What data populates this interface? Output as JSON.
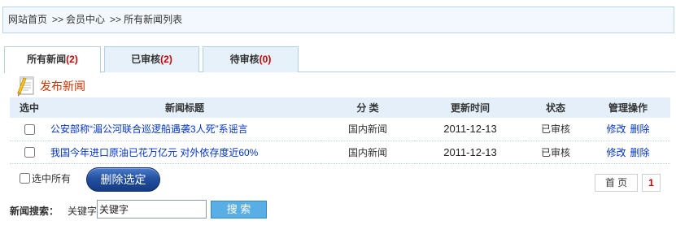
{
  "breadcrumb": {
    "items": [
      "网站首页",
      "会员中心",
      "所有新闻列表"
    ],
    "separator": ">>"
  },
  "tabs": [
    {
      "label": "所有新闻",
      "count": "(2)",
      "active": true
    },
    {
      "label": "已审核",
      "count": "(2)",
      "active": false
    },
    {
      "label": "待审核",
      "count": "(0)",
      "active": false
    }
  ],
  "publish": {
    "label": "发布新闻",
    "icon": "notepad-pencil-icon"
  },
  "table": {
    "headers": [
      "选中",
      "新闻标题",
      "分 类",
      "更新时间",
      "状态",
      "管理操作"
    ],
    "rows": [
      {
        "checked": false,
        "title": "公安部称“湄公河联合巡逻船遇袭3人死”系谣言",
        "category": "国内新闻",
        "updated": "2011-12-13",
        "status": "已审核",
        "edit_label": "修改",
        "delete_label": "删除"
      },
      {
        "checked": false,
        "title": "我国今年进口原油已花万亿元 对外依存度近60%",
        "category": "国内新闻",
        "updated": "2011-12-13",
        "status": "已审核",
        "edit_label": "修改",
        "delete_label": "删除"
      }
    ]
  },
  "bulk": {
    "select_all_label": "选中所有",
    "delete_selected_label": "删除选定"
  },
  "pagination": {
    "first_label": "首 页",
    "current_page": "1"
  },
  "search": {
    "label": "新闻搜索：",
    "keyword_label": "关键字",
    "input_value": "关键字",
    "button_label": "搜 索"
  },
  "colors": {
    "link": "#0033cc",
    "publish_text": "#cc3300",
    "tab_count": "#cc0000",
    "header_bg": "#e4effa",
    "delete_button": "#1c4592",
    "search_button": "#5aaee6",
    "current_page": "#cc0000"
  }
}
